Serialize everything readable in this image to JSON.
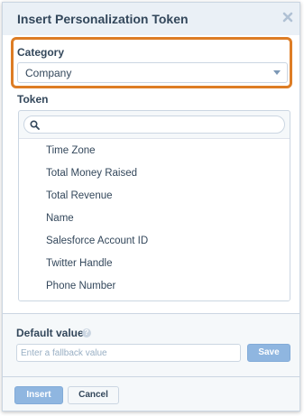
{
  "dialog": {
    "title": "Insert Personalization Token"
  },
  "category": {
    "label": "Category",
    "selected": "Company"
  },
  "token": {
    "label": "Token",
    "search_value": "",
    "items": [
      "Time Zone",
      "Total Money Raised",
      "Total Revenue",
      "Name",
      "Salesforce Account ID",
      "Twitter Handle",
      "Phone Number"
    ]
  },
  "default_value": {
    "label": "Default value",
    "help_glyph": "?",
    "placeholder": "Enter a fallback value",
    "save_label": "Save"
  },
  "actions": {
    "insert_label": "Insert",
    "cancel_label": "Cancel"
  },
  "colors": {
    "highlight": "#dd7d25",
    "primary_button": "#8fb6e0",
    "header_bg": "#eaf0f6"
  }
}
